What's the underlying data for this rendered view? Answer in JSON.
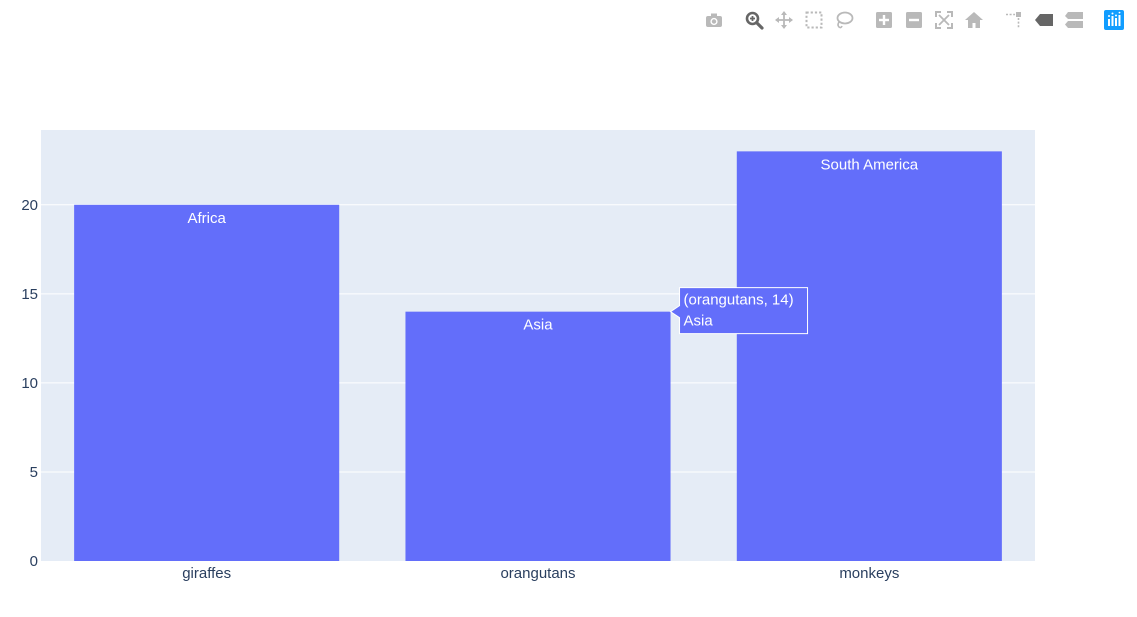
{
  "modebar": {
    "buttons": [
      {
        "group": 0,
        "icon": "camera-icon",
        "active": false
      },
      {
        "group": 1,
        "icon": "zoom-icon",
        "active": true
      },
      {
        "group": 1,
        "icon": "pan-icon",
        "active": false
      },
      {
        "group": 1,
        "icon": "box-select-icon",
        "active": false
      },
      {
        "group": 1,
        "icon": "lasso-select-icon",
        "active": false
      },
      {
        "group": 2,
        "icon": "zoom-in-icon",
        "active": false
      },
      {
        "group": 2,
        "icon": "zoom-out-icon",
        "active": false
      },
      {
        "group": 2,
        "icon": "autoscale-icon",
        "active": false
      },
      {
        "group": 2,
        "icon": "reset-axes-icon",
        "active": false
      },
      {
        "group": 3,
        "icon": "spike-lines-icon",
        "active": false
      },
      {
        "group": 3,
        "icon": "hover-closest-icon",
        "active": true
      },
      {
        "group": 3,
        "icon": "hover-compare-icon",
        "active": false
      },
      {
        "group": 4,
        "icon": "plotly-logo-icon",
        "active": false
      }
    ]
  },
  "colors": {
    "bar": "#636efa",
    "plot_bg": "#e5ecf6",
    "grid": "#ffffff",
    "tick_text": "#2a3f5f",
    "icon_inactive": "#b9b9b9",
    "icon_active": "#666666",
    "plotly_logo": "#119dff"
  },
  "chart_data": {
    "type": "bar",
    "categories": [
      "giraffes",
      "orangutans",
      "monkeys"
    ],
    "values": [
      20,
      14,
      23
    ],
    "bar_labels": [
      "Africa",
      "Asia",
      "South America"
    ],
    "title": "",
    "xlabel": "",
    "ylabel": "",
    "ylim": [
      0,
      24.2
    ],
    "yticks": [
      0,
      5,
      10,
      15,
      20
    ],
    "grid": true,
    "legend": "none"
  },
  "tooltip": {
    "category_index": 1,
    "line1": "(orangutans, 14)",
    "line2": "Asia"
  }
}
